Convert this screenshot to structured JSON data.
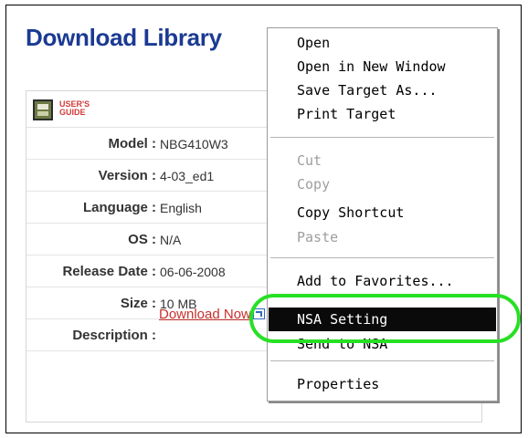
{
  "page": {
    "title": "Download Library"
  },
  "library": {
    "guide_label": "USER'S GUIDE",
    "rows": [
      {
        "label": "Model :",
        "value": "NBG410W3"
      },
      {
        "label": "Version :",
        "value": "4-03_ed1"
      },
      {
        "label": "Language :",
        "value": "English"
      },
      {
        "label": "OS :",
        "value": "N/A"
      },
      {
        "label": "Release Date :",
        "value": "06-06-2008"
      },
      {
        "label": "Size :",
        "value": "10 MB"
      },
      {
        "label": "Description :",
        "value": ""
      }
    ],
    "download_label": "Download Now",
    "download_icon": "external-link-icon"
  },
  "context_menu": {
    "items": [
      {
        "label": "Open",
        "enabled": true
      },
      {
        "label": "Open in New Window",
        "enabled": true
      },
      {
        "label": "Save Target As...",
        "enabled": true
      },
      {
        "label": "Print Target",
        "enabled": true
      },
      {
        "label": "Cut",
        "enabled": false
      },
      {
        "label": "Copy",
        "enabled": false
      },
      {
        "label": "Copy Shortcut",
        "enabled": true
      },
      {
        "label": "Paste",
        "enabled": false
      },
      {
        "label": "Add to Favorites...",
        "enabled": true
      },
      {
        "label": "NSA Setting",
        "enabled": true,
        "selected": true
      },
      {
        "label": "Send to NSA",
        "enabled": true
      },
      {
        "label": "Properties",
        "enabled": true
      }
    ]
  },
  "colors": {
    "title": "#1b3a93",
    "link": "#c9302c",
    "highlight_ring": "#27e024",
    "selected_item_bg": "#0a0a0a"
  }
}
